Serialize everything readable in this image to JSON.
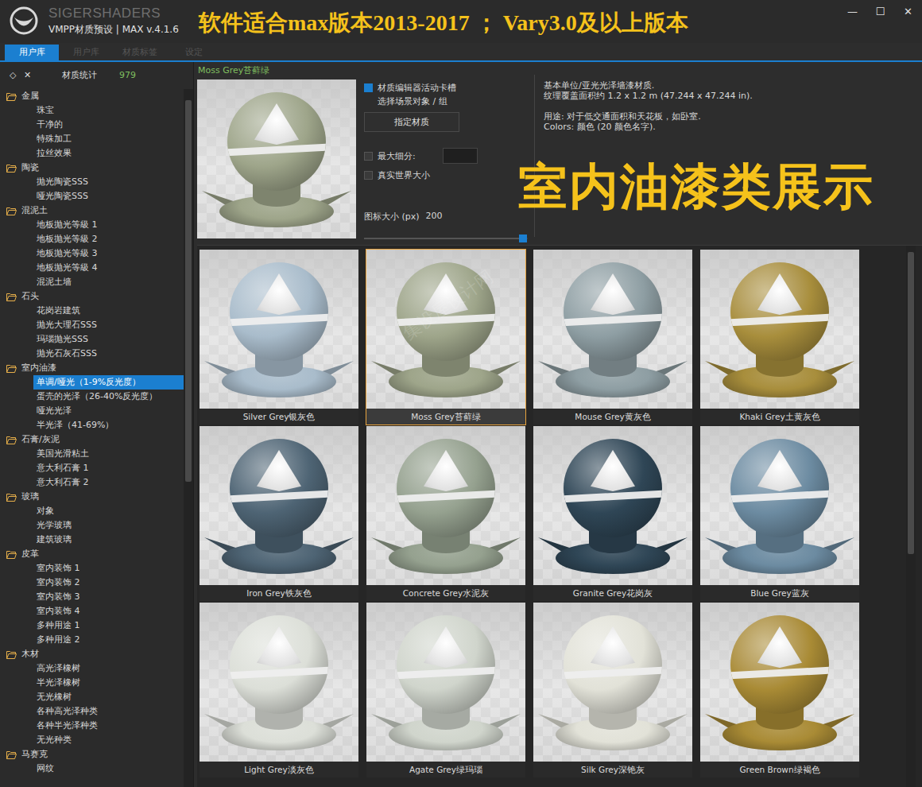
{
  "window": {
    "brand": "SIGERSHADERS",
    "title": "VMPP材质预设 | MAX v.4.1.6",
    "banner": "软件适合max版本2013-2017 ； Vary3.0及以上版本",
    "controls": [
      "—",
      "☐",
      "✕"
    ]
  },
  "tabs": [
    {
      "label": "用户库",
      "selected": true
    },
    {
      "label": "用户库",
      "selected": false
    },
    {
      "label": "材质标签",
      "selected": false
    },
    {
      "label": "设定",
      "selected": false
    }
  ],
  "sidebar": {
    "tools": [
      "◇",
      "✕"
    ],
    "stat_label": "材质统计",
    "stat_count": "979",
    "categories": [
      {
        "name": "金属",
        "expanded": true,
        "items": [
          {
            "label": "珠宝",
            "selected": false
          },
          {
            "label": "干净的",
            "selected": false
          },
          {
            "label": "特殊加工",
            "selected": false
          },
          {
            "label": "拉丝效果",
            "selected": false
          }
        ]
      },
      {
        "name": "陶瓷",
        "expanded": true,
        "items": [
          {
            "label": "抛光陶瓷SSS",
            "selected": false
          },
          {
            "label": "哑光陶瓷SSS",
            "selected": false
          }
        ]
      },
      {
        "name": "混泥土",
        "expanded": true,
        "items": [
          {
            "label": "地板抛光等級 1",
            "selected": false
          },
          {
            "label": "地板抛光等級 2",
            "selected": false
          },
          {
            "label": "地板抛光等級 3",
            "selected": false
          },
          {
            "label": "地板抛光等級 4",
            "selected": false
          },
          {
            "label": "混泥土墙",
            "selected": false
          }
        ]
      },
      {
        "name": "石头",
        "expanded": true,
        "items": [
          {
            "label": "花岗岩建筑",
            "selected": false
          },
          {
            "label": "抛光大理石SSS",
            "selected": false
          },
          {
            "label": "玛瑙抛光SSS",
            "selected": false
          },
          {
            "label": "抛光石灰石SSS",
            "selected": false
          }
        ]
      },
      {
        "name": "室内油漆",
        "expanded": true,
        "items": [
          {
            "label": "单调/哑光（1-9%反光度）",
            "selected": true
          },
          {
            "label": "蛋壳的光泽（26-40%反光度）",
            "selected": false
          },
          {
            "label": "哑光光泽",
            "selected": false
          },
          {
            "label": "半光泽（41-69%）",
            "selected": false
          }
        ]
      },
      {
        "name": "石膏/灰泥",
        "expanded": true,
        "items": [
          {
            "label": "美国光滑粘土",
            "selected": false
          },
          {
            "label": "意大利石膏 1",
            "selected": false
          },
          {
            "label": "意大利石膏 2",
            "selected": false
          }
        ]
      },
      {
        "name": "玻璃",
        "expanded": true,
        "items": [
          {
            "label": "对象",
            "selected": false
          },
          {
            "label": "光学玻璃",
            "selected": false
          },
          {
            "label": "建筑玻璃",
            "selected": false
          }
        ]
      },
      {
        "name": "皮革",
        "expanded": true,
        "items": [
          {
            "label": "室内装饰 1",
            "selected": false
          },
          {
            "label": "室内装饰 2",
            "selected": false
          },
          {
            "label": "室内装饰 3",
            "selected": false
          },
          {
            "label": "室内装饰 4",
            "selected": false
          },
          {
            "label": "多种用途 1",
            "selected": false
          },
          {
            "label": "多种用途 2",
            "selected": false
          }
        ]
      },
      {
        "name": "木材",
        "expanded": true,
        "items": [
          {
            "label": "高光泽橡树",
            "selected": false
          },
          {
            "label": "半光泽橡树",
            "selected": false
          },
          {
            "label": "无光橡树",
            "selected": false
          },
          {
            "label": "各种高光泽种类",
            "selected": false
          },
          {
            "label": "各种半光泽种类",
            "selected": false
          },
          {
            "label": "无光种类",
            "selected": false
          }
        ]
      },
      {
        "name": "马赛克",
        "expanded": true,
        "items": [
          {
            "label": "网纹",
            "selected": false
          }
        ]
      }
    ]
  },
  "preview": {
    "name": "Moss Grey苔藓绿",
    "color": "#9ea58a"
  },
  "options": {
    "slot": {
      "label": "材质编辑器活动卡槽",
      "checked": true
    },
    "select_label": "选择场景对象 / 组",
    "assign_button": "指定材质",
    "max_subdiv": {
      "label": "最大细分:",
      "checked": false,
      "value": ""
    },
    "real_world": {
      "label": "真实世界大小",
      "checked": false
    },
    "icon_size": {
      "label": "图标大小 (px)",
      "value": "200",
      "level": 0.97
    }
  },
  "description": [
    [
      "基本单位/亚光光泽墙漆材质.",
      "纹理覆盖面积约 1.2 x 1.2 m (47.244 x 47.244 in)."
    ],
    [
      "用途: 对于低交通面积和天花板，如卧室.",
      "Colors: 颜色 (20 颜色名字)."
    ]
  ],
  "overlay_caption": "室内油漆类展示",
  "watermark": "集设屋设计网",
  "materials": [
    {
      "name": "Silver Grey银灰色",
      "color": "#a9bccb",
      "selected": false
    },
    {
      "name": "Moss Grey苔藓绿",
      "color": "#9ea58a",
      "selected": true
    },
    {
      "name": "Mouse Grey黄灰色",
      "color": "#8e9ea3",
      "selected": false
    },
    {
      "name": "Khaki Grey土黄灰色",
      "color": "#a88e3c",
      "selected": false
    },
    {
      "name": "Iron Grey铁灰色",
      "color": "#4e6474",
      "selected": false
    },
    {
      "name": "Concrete Grey水泥灰",
      "color": "#95a18f",
      "selected": false
    },
    {
      "name": "Granite Grey花岗灰",
      "color": "#2f4656",
      "selected": false
    },
    {
      "name": "Blue Grey蓝灰",
      "color": "#6c8ba1",
      "selected": false
    },
    {
      "name": "Light Grey淡灰色",
      "color": "#dcdfd8",
      "selected": false
    },
    {
      "name": "Agate Grey绿玛瑙",
      "color": "#d0d5cc",
      "selected": false
    },
    {
      "name": "Silk Grey深铯灰",
      "color": "#e2e2d8",
      "selected": false
    },
    {
      "name": "Green Brown绿褐色",
      "color": "#a98b35",
      "selected": false
    }
  ]
}
